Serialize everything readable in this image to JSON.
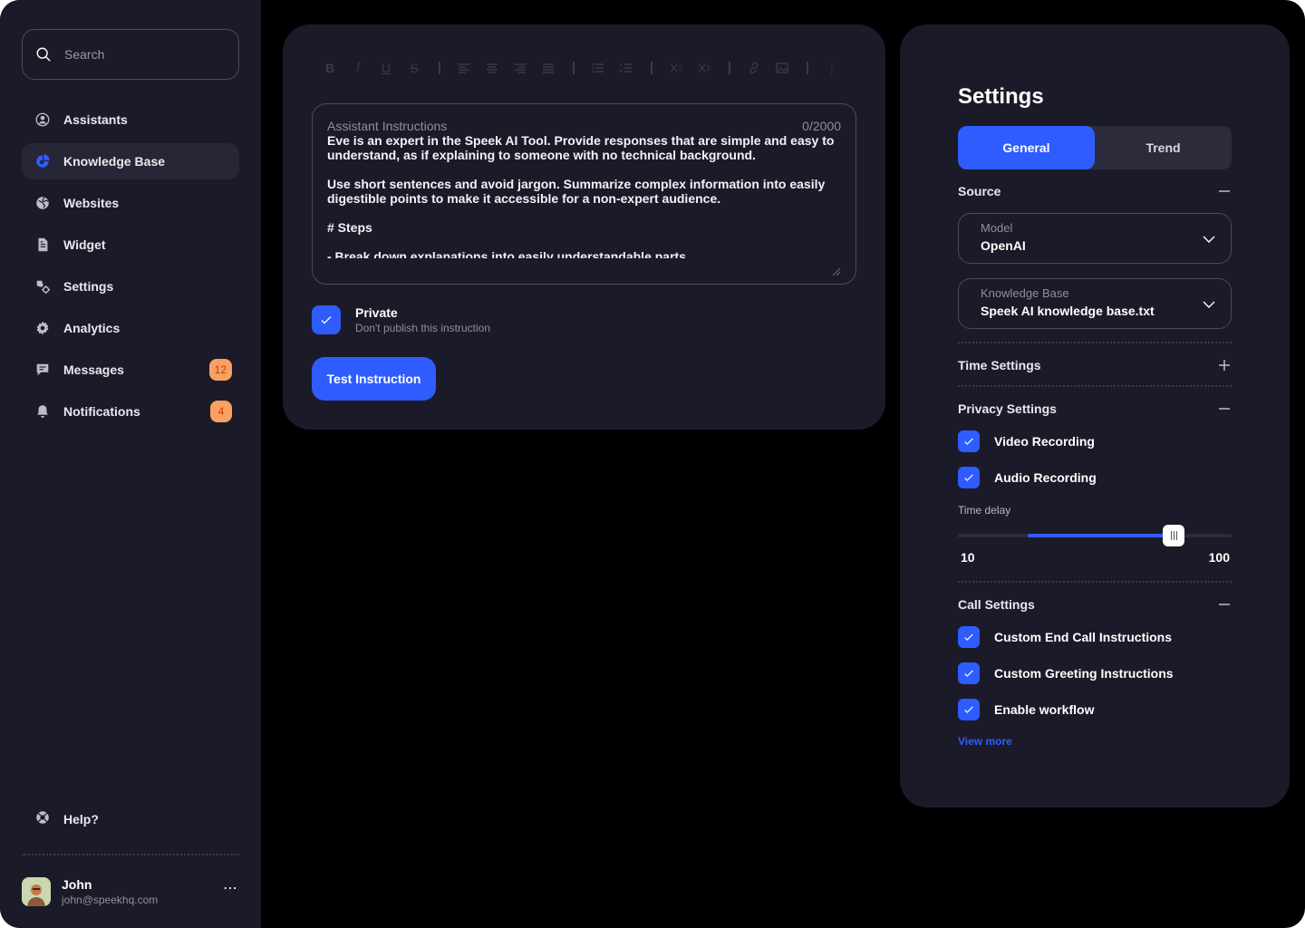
{
  "sidebar": {
    "search_placeholder": "Search",
    "items": [
      {
        "label": "Assistants"
      },
      {
        "label": "Knowledge Base",
        "active": true
      },
      {
        "label": "Websites"
      },
      {
        "label": "Widget"
      },
      {
        "label": "Settings"
      },
      {
        "label": "Analytics"
      },
      {
        "label": "Messages",
        "badge": "12"
      },
      {
        "label": "Notifications",
        "badge": "4"
      }
    ],
    "help_label": "Help?",
    "user": {
      "name": "John",
      "email": "john@speekhq.com"
    }
  },
  "editor": {
    "toolbar_icons": [
      "bold-icon",
      "italic-icon",
      "underline-icon",
      "strikethrough-icon",
      "align-left-icon",
      "align-center-icon",
      "align-right-icon",
      "align-justify-icon",
      "bullet-list-icon",
      "numbered-list-icon",
      "superscript-icon",
      "subscript-icon",
      "link-icon",
      "image-icon",
      "more-vertical-icon"
    ],
    "field_label": "Assistant Instructions",
    "char_count": "0/2000",
    "text": "Eve is an expert in the Speek AI Tool. Provide responses that are simple and easy to understand, as if explaining to someone with no technical background.\n\nUse short sentences and avoid jargon. Summarize complex information into easily digestible points to make it accessible for a non-expert audience.\n\n# Steps\n\n- Break down explanations into easily understandable parts.",
    "private_title": "Private",
    "private_sub": "Don't publish this instruction",
    "test_button": "Test Instruction"
  },
  "settings": {
    "title": "Settings",
    "tabs": [
      {
        "label": "General",
        "active": true
      },
      {
        "label": "Trend"
      }
    ],
    "source": {
      "heading": "Source",
      "model": {
        "label": "Model",
        "value": "OpenAI"
      },
      "knowledge_base": {
        "label": "Knowledge Base",
        "value": "Speek AI knowledge base.txt"
      }
    },
    "time_settings": {
      "heading": "Time Settings"
    },
    "privacy": {
      "heading": "Privacy Settings",
      "video": "Video Recording",
      "audio": "Audio Recording",
      "time_delay_label": "Time delay",
      "slider_min": "10",
      "slider_max": "100",
      "slider_low_value": 33,
      "slider_high_value": 81
    },
    "call": {
      "heading": "Call Settings",
      "end_call": "Custom End Call Instructions",
      "greeting": "Custom Greeting Instructions",
      "workflow": "Enable workflow"
    },
    "view_more": "View more"
  },
  "colors": {
    "accent": "#2f5cff",
    "panel": "#1b1a29",
    "badge": "#f8a162"
  }
}
